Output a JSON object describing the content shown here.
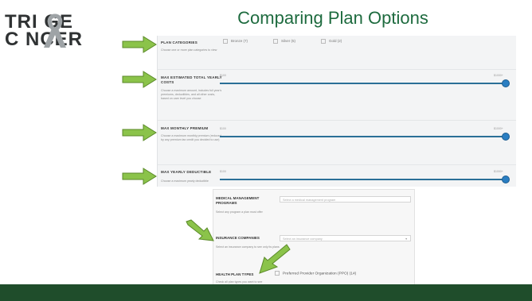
{
  "slide_title": "Comparing Plan Options",
  "logo": {
    "line1": "TRI GE",
    "line2": "C NCER",
    "full": "TRIAGE CANCER"
  },
  "colors": {
    "title_green": "#1e6b3f",
    "arrow_fill": "#8bc34a",
    "slider_blue": "#2a7ec2",
    "bottom_bar": "#1f4d2b"
  },
  "filters": {
    "plan_categories": {
      "label": "PLAN CATEGORIES",
      "desc": "Choose one or more plan categories to view",
      "options": [
        "Bronze (7)",
        "Silver (5)",
        "Gold (2)"
      ]
    },
    "max_total_costs": {
      "label": "MAX ESTIMATED TOTAL YEARLY COSTS",
      "desc": "Choose a maximum amount, includes full year's premiums, deductibles, and all other costs, based on care level you choose",
      "min": "$100",
      "max": "$1000+"
    },
    "max_monthly_premium": {
      "label": "MAX MONTHLY PREMIUM",
      "desc": "Choose a maximum monthly premium (reduced by any premium tax credit you decided to use)",
      "min": "$100",
      "max": "$1000+"
    },
    "max_yearly_deductible": {
      "label": "MAX YEARLY DEDUCTIBLE",
      "desc": "Choose a maximum yearly deductible",
      "min": "$100",
      "max": "$1000+"
    },
    "medical_management": {
      "label": "MEDICAL MANAGEMENT PROGRAMS",
      "desc": "Select any program a plan must offer",
      "placeholder": "Select a medical management program"
    },
    "insurance_companies": {
      "label": "INSURANCE COMPANIES",
      "desc": "Select an insurance company to see only its plans",
      "placeholder": "Select an insurance company"
    },
    "health_plan_types": {
      "label": "HEALTH PLAN TYPES",
      "desc": "Check all plan types you want to see",
      "option": "Preferred Provider Organization (PPO) (14)"
    }
  }
}
